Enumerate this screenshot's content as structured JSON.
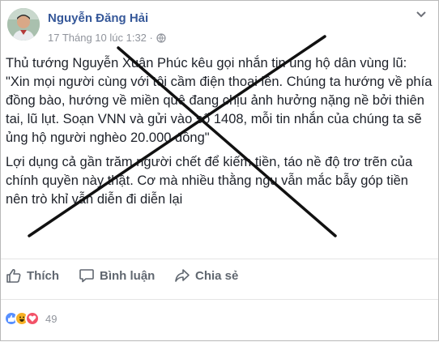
{
  "post": {
    "author": "Nguyễn Đăng Hải",
    "timestamp": "17 Tháng 10 lúc 1:32 ·",
    "privacy_icon": "globe-icon",
    "paragraphs": [
      "Thủ tướng Nguyễn Xuân Phúc kêu gọi nhắn tin ủng hộ dân vùng lũ: \"Xin mọi người cùng với tôi cầm điện thoại lên. Chúng ta hướng về phía đồng bào, hướng về miền quê đang chịu ảnh hưởng nặng nề bởi thiên tai, lũ lụt. Soạn VNN và gửi vào số 1408, mỗi tin nhắn của chúng ta sẽ ủng hộ người nghèo 20.000 đồng\"",
      "Lợi dụng cả gần trăm người chết để kiếm tiền, táo nề độ trơ trẽn của chính quyền này thật. Cơ mà nhiều thằng ngu vẫn mắc bẫy góp tiền nên trò khỉ vẫn diễn đi diễn lại"
    ]
  },
  "actions": {
    "like_label": "Thích",
    "comment_label": "Bình luận",
    "share_label": "Chia sẻ"
  },
  "reactions": {
    "types": [
      "like",
      "haha",
      "love"
    ],
    "count": "49"
  },
  "colors": {
    "author": "#365899",
    "meta": "#90949c",
    "text": "#1d2129",
    "cross": "#111111"
  }
}
